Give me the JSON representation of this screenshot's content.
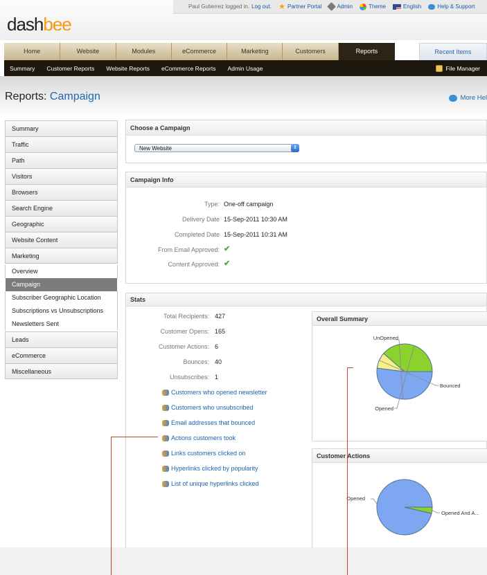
{
  "header": {
    "logo_part1": "dash",
    "logo_part2": "bee",
    "logged_in_text": "Paul Gutierrez logged in.",
    "logout": "Log out.",
    "links": [
      {
        "label": "Partner Portal",
        "icon": "star-icon",
        "color": "#f0a21a"
      },
      {
        "label": "Admin",
        "icon": "wrench-icon",
        "color": "#6d6d6d"
      },
      {
        "label": "Theme",
        "icon": "color-wheel-icon",
        "color": "#d04fd0"
      },
      {
        "label": "English",
        "icon": "flag-icon",
        "color": "#b0324a"
      },
      {
        "label": "Help & Support",
        "icon": "chat-bubble-icon",
        "color": "#3b8fd6"
      }
    ]
  },
  "nav": {
    "tabs": [
      "Home",
      "Website",
      "Modules",
      "eCommerce",
      "Marketing",
      "Customers",
      "Reports"
    ],
    "active_tab": "Reports",
    "recent": "Recent Items",
    "subnav": [
      "Summary",
      "Customer Reports",
      "Website Reports",
      "eCommerce Reports",
      "Admin Usage"
    ],
    "file_manager": "File Manager"
  },
  "page": {
    "title_prefix": "Reports:",
    "title_main": "Campaign",
    "more_help": "More Hel"
  },
  "sidebar": {
    "top": [
      "Summary",
      "Traffic",
      "Path",
      "Visitors",
      "Browsers",
      "Search Engine",
      "Geographic",
      "Website Content",
      "Marketing"
    ],
    "marketing_sub": [
      "Overview",
      "Campaign",
      "Subscriber Geographic Location",
      "Subscriptions vs Unsubscriptions",
      "Newsletters Sent"
    ],
    "active_sub": "Campaign",
    "bottom": [
      "Leads",
      "eCommerce",
      "Miscellaneous"
    ]
  },
  "choose": {
    "title": "Choose a Campaign",
    "selected": "New Website"
  },
  "info": {
    "title": "Campaign Info",
    "rows": [
      {
        "label": "Type:",
        "value": "One-off campaign"
      },
      {
        "label": "Delivery Date",
        "value": "15-Sep-2011 10:30 AM"
      },
      {
        "label": "Completed Date",
        "value": "15-Sep-2011 10:31 AM"
      },
      {
        "label": "From Email Approved:",
        "value": "✔"
      },
      {
        "label": "Content Approved:",
        "value": "✔"
      }
    ]
  },
  "stats": {
    "title": "Stats",
    "rows": [
      {
        "label": "Total Recipients:",
        "value": "427"
      },
      {
        "label": "Customer Opens:",
        "value": "165"
      },
      {
        "label": "Customer Actions:",
        "value": "6"
      },
      {
        "label": "Bounces:",
        "value": "40"
      },
      {
        "label": "Unsubscribes:",
        "value": "1"
      }
    ],
    "links": [
      "Customers who opened newsletter",
      "Customers who unsubscribed",
      "Email addresses that bounced",
      "Actions customers took",
      "Links customers clicked on",
      "Hyperlinks clicked by popularity",
      "List of unique hyperlinks clicked"
    ]
  },
  "chart_data": [
    {
      "type": "pie",
      "title": "Overall Summary",
      "categories": [
        "UnOpened",
        "Bounced",
        "Opened"
      ],
      "values": [
        222,
        40,
        165
      ],
      "colors": [
        "#7ea7f2",
        "#f6f08a",
        "#8cd22c"
      ]
    },
    {
      "type": "pie",
      "title": "Customer Actions",
      "categories": [
        "Opened",
        "Opened And A..."
      ],
      "values": [
        159,
        6
      ],
      "colors": [
        "#7ea7f2",
        "#8cd22c"
      ]
    }
  ]
}
